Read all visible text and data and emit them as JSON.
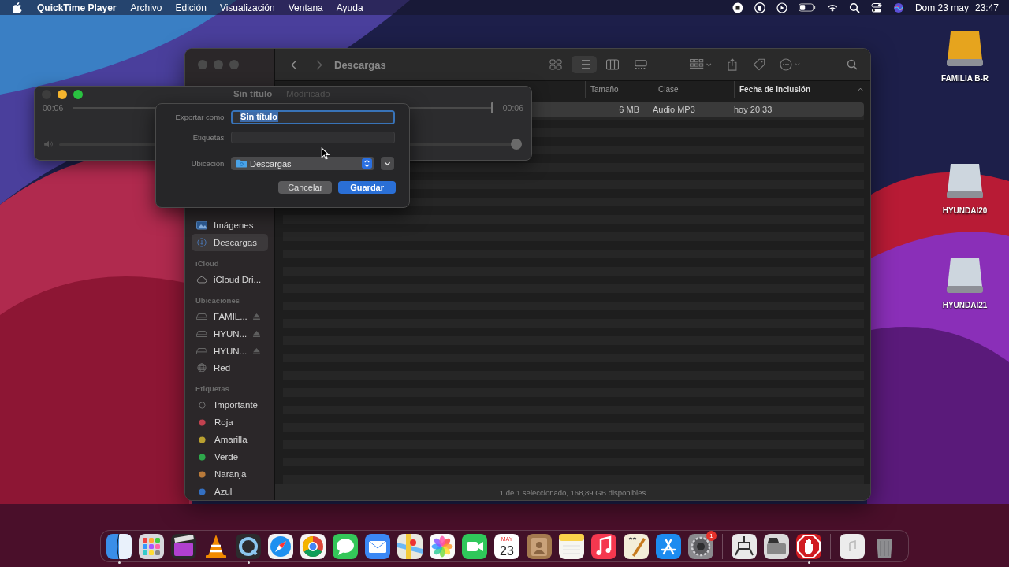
{
  "menu_bar": {
    "app": "QuickTime Player",
    "menus": [
      "Archivo",
      "Edición",
      "Visualización",
      "Ventana",
      "Ayuda"
    ],
    "date": "Dom 23 may",
    "time": "23:47"
  },
  "finder": {
    "title": "Descargas",
    "view_modes": [
      {
        "selected": false
      },
      {
        "selected": true
      },
      {
        "selected": false
      },
      {
        "selected": false
      }
    ],
    "sidebar": [
      {
        "items": [
          {
            "label": "Imágenes",
            "kind": "pictures",
            "selected": false
          },
          {
            "label": "Descargas",
            "kind": "downloads",
            "selected": true
          }
        ]
      },
      {
        "title": "iCloud",
        "items": [
          {
            "label": "iCloud Dri...",
            "kind": "cloud",
            "selected": false
          }
        ]
      },
      {
        "title": "Ubicaciones",
        "items": [
          {
            "label": "FAMIL...",
            "kind": "drive",
            "ejectable": true,
            "selected": false
          },
          {
            "label": "HYUN...",
            "kind": "drive",
            "ejectable": true,
            "selected": false
          },
          {
            "label": "HYUN...",
            "kind": "drive",
            "ejectable": true,
            "selected": false
          },
          {
            "label": "Red",
            "kind": "network",
            "selected": false
          }
        ]
      },
      {
        "title": "Etiquetas",
        "items": [
          {
            "label": "Importante",
            "kind": "tag",
            "selected": false
          },
          {
            "label": "Roja",
            "kind": "tag",
            "color": "#c2414f",
            "selected": false
          },
          {
            "label": "Amarilla",
            "kind": "tag",
            "color": "#b9a030",
            "selected": false
          },
          {
            "label": "Verde",
            "kind": "tag",
            "color": "#2ea84b",
            "selected": false
          },
          {
            "label": "Naranja",
            "kind": "tag",
            "color": "#b97a3a",
            "selected": false
          },
          {
            "label": "Azul",
            "kind": "tag",
            "color": "#3470c2",
            "selected": false
          }
        ]
      }
    ],
    "columns": [
      {
        "label": "Tamaño",
        "sorted": false
      },
      {
        "label": "Clase",
        "sorted": false
      },
      {
        "label": "Fecha de inclusión",
        "sorted": true
      }
    ],
    "rows": [
      {
        "size": "6 MB",
        "class": "Audio MP3",
        "date": "hoy 20:33",
        "selected": true
      }
    ],
    "status": "1 de 1 seleccionado, 168,89 GB disponibles"
  },
  "quicktime": {
    "title": "Sin título",
    "subtitle": "— Modificado",
    "time_elapsed": "00:06",
    "time_total": "00:06",
    "position": {
      "level": 1
    },
    "volume": {
      "level": 1
    }
  },
  "dialog": {
    "export_as": {
      "label": "Exportar como:",
      "value": "Sin título"
    },
    "tags": {
      "label": "Etiquetas:"
    },
    "location": {
      "label": "Ubicación:",
      "value": "Descargas"
    },
    "buttons": [
      {
        "label": "Cancelar",
        "default": false
      },
      {
        "label": "Guardar",
        "default": true
      }
    ]
  },
  "desktop_icons": [
    {
      "label": "FAMILIA B-R",
      "color": "#e6a41e"
    },
    {
      "label": "HYUNDAI20",
      "color": "#cdd6de"
    },
    {
      "label": "HYUNDAI21",
      "color": "#cdd6de"
    }
  ],
  "dock": {
    "groups": [
      [
        {
          "running": true
        },
        {
          "running": false
        },
        {
          "running": false
        },
        {
          "running": false
        },
        {
          "running": true
        },
        {
          "running": false
        },
        {
          "running": false
        },
        {
          "running": false
        },
        {
          "running": false
        },
        {
          "running": false
        },
        {
          "running": false
        },
        {
          "running": false
        },
        {
          "running": false,
          "month": "MAY",
          "day": "23"
        },
        {
          "running": false
        },
        {
          "running": false
        },
        {
          "running": false
        },
        {
          "running": false
        },
        {
          "running": false
        },
        {
          "running": false,
          "badge": "1"
        }
      ],
      [
        {
          "running": false
        },
        {
          "running": false
        },
        {
          "running": true
        }
      ],
      [
        {
          "running": false
        },
        {
          "running": false
        }
      ]
    ]
  }
}
